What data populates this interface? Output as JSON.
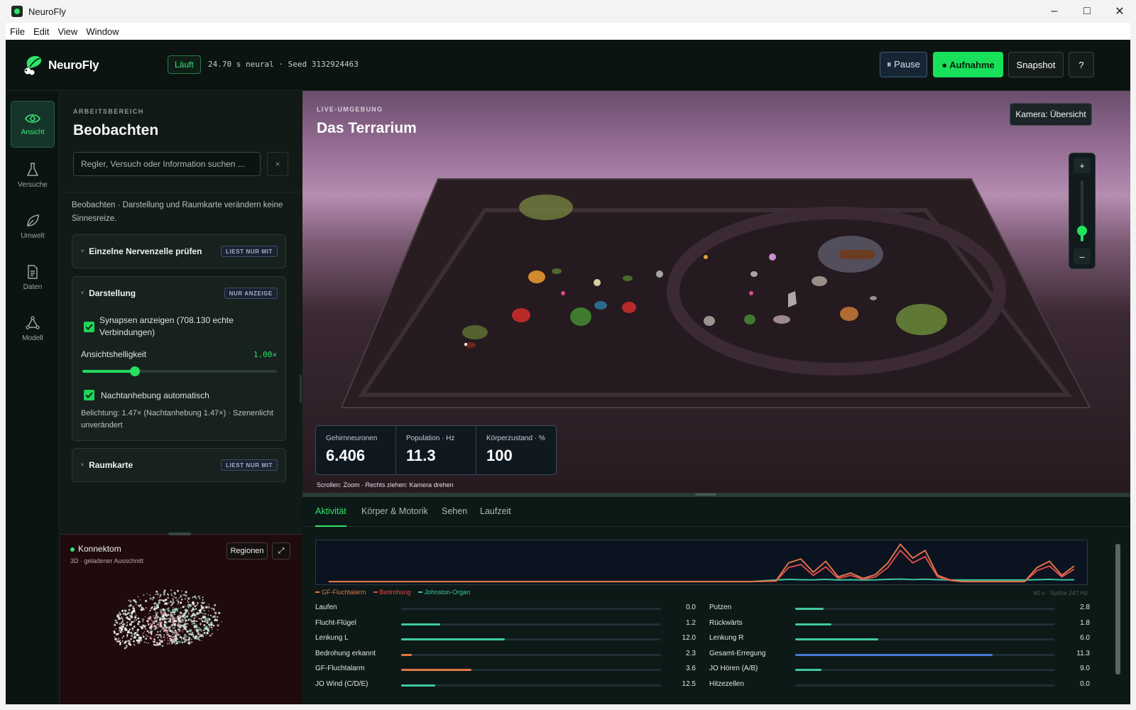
{
  "window": {
    "title": "NeuroFly",
    "minimize": "–",
    "maximize": "□",
    "close": "✕"
  },
  "menu": [
    "File",
    "Edit",
    "View",
    "Window"
  ],
  "header": {
    "logo": "NeuroFly",
    "status": "Läuft",
    "info": "24.70 s neural · Seed 3132924463",
    "pause": "⏸ Pause",
    "record": "● Aufnahme",
    "snapshot": "Snapshot",
    "help": "?"
  },
  "colors": {
    "accent": "#2fe36b",
    "record": "#18e05a"
  },
  "rail": [
    {
      "label": "Ansicht",
      "icon": "eye-icon",
      "active": true
    },
    {
      "label": "Versuche",
      "icon": "flask-icon",
      "active": false
    },
    {
      "label": "Umwelt",
      "icon": "leaf-icon",
      "active": false
    },
    {
      "label": "Daten",
      "icon": "document-icon",
      "active": false
    },
    {
      "label": "Modell",
      "icon": "graph-icon",
      "active": false
    }
  ],
  "workspace": {
    "label": "ARBEITSBEREICH",
    "title": "Beobachten",
    "search_placeholder": "Regler, Versuch oder Information suchen ...",
    "search_clear": "×",
    "description": "Beobachten · Darstellung und Raumkarte verändern keine Sinnesreize.",
    "sections": {
      "neuron": {
        "title": "Einzelne Nervenzelle prüfen",
        "badge": "LIEST NUR MIT",
        "caret": "˅"
      },
      "display": {
        "title": "Darstellung",
        "badge": "NUR ANZEIGE",
        "caret": "˅",
        "synapses_label": "Synapsen anzeigen (708.130 echte Verbindungen)",
        "synapses_checked": true,
        "brightness_label": "Ansichtshelligkeit",
        "brightness_value": "1.00×",
        "brightness_fraction": 0.27,
        "night_label": "Nachtanhebung automatisch",
        "night_checked": true,
        "exposure": "Belichtung: 1.47× (Nachtanhebung 1.47×) · Szenenlicht unverändert"
      },
      "map": {
        "title": "Raumkarte",
        "badge": "LIEST NUR MIT",
        "caret": "˅"
      }
    }
  },
  "connectome": {
    "title": "Konnektom",
    "subtitle": "3D · geladener Ausschnitt",
    "regions": "Regionen",
    "expand": "⤢"
  },
  "viewport": {
    "label": "LIVE-UMGEBUNG",
    "title": "Das Terrarium",
    "camera": "Kamera: Übersicht",
    "zoom_in": "+",
    "zoom_out": "–",
    "zoom_fraction": 0.18,
    "stats": [
      {
        "label": "Gehirnneuronen",
        "value": "6.406"
      },
      {
        "label": "Population · Hz",
        "value": "11.3"
      },
      {
        "label": "Körperzustand · %",
        "value": "100"
      }
    ],
    "hint": "Scrollen: Zoom · Rechts ziehen: Kamera drehen"
  },
  "tabs": [
    "Aktivität",
    "Körper & Motorik",
    "Sehen",
    "Laufzeit"
  ],
  "activity": {
    "legend": [
      {
        "name": "GF-Fluchtalarm",
        "color": "#e0764a"
      },
      {
        "name": "Bedrohung",
        "color": "#e04a4a"
      },
      {
        "name": "Johnston-Organ",
        "color": "#3ec9a0"
      }
    ],
    "caption": "60 s · Spitze 247 Hz",
    "left_metrics": [
      {
        "label": "Laufen",
        "value": "0.0",
        "fraction": 0.0,
        "color": "#3ec9a0"
      },
      {
        "label": "Flucht-Flügel",
        "value": "1.2",
        "fraction": 0.15,
        "color": "#3ec9a0"
      },
      {
        "label": "Lenkung L",
        "value": "12.0",
        "fraction": 0.4,
        "color": "#3ec9a0"
      },
      {
        "label": "Bedrohung erkannt",
        "value": "2.3",
        "fraction": 0.04,
        "color": "#e0764a"
      },
      {
        "label": "GF-Fluchtalarm",
        "value": "3.6",
        "fraction": 0.27,
        "color": "#e0764a"
      },
      {
        "label": "JO Wind (C/D/E)",
        "value": "12.5",
        "fraction": 0.13,
        "color": "#3ec9a0"
      }
    ],
    "right_metrics": [
      {
        "label": "Putzen",
        "value": "2.8",
        "fraction": 0.11,
        "color": "#3ec9a0"
      },
      {
        "label": "Rückwärts",
        "value": "1.8",
        "fraction": 0.14,
        "color": "#3ec9a0"
      },
      {
        "label": "Lenkung R",
        "value": "6.0",
        "fraction": 0.32,
        "color": "#3ec9a0"
      },
      {
        "label": "Gesamt-Erregung",
        "value": "11.3",
        "fraction": 0.76,
        "color": "#4a78d6"
      },
      {
        "label": "JO Hören (A/B)",
        "value": "9.0",
        "fraction": 0.1,
        "color": "#3ec9a0"
      },
      {
        "label": "Hitzezellen",
        "value": "0.0",
        "fraction": 0.0,
        "color": "#3ec9a0"
      }
    ]
  },
  "chart_data": {
    "type": "line",
    "title": "",
    "xlabel": "",
    "ylabel": "",
    "x": [
      0,
      2,
      4,
      6,
      8,
      10,
      12,
      14,
      16,
      18,
      20,
      22,
      24,
      26,
      28,
      30,
      32,
      34,
      36,
      37,
      38,
      39,
      40,
      41,
      42,
      43,
      44,
      45,
      46,
      47,
      48,
      49,
      50,
      51,
      52,
      53,
      54,
      55,
      56,
      57,
      58,
      59,
      60
    ],
    "ylim": [
      0,
      247
    ],
    "grid": false,
    "legend_position": "bottom-left",
    "series": [
      {
        "name": "GF-Fluchtalarm",
        "color": "#e0764a",
        "values": [
          0,
          0,
          0,
          0,
          0,
          0,
          0,
          0,
          0,
          0,
          0,
          0,
          0,
          0,
          0,
          0,
          0,
          0,
          5,
          120,
          145,
          60,
          130,
          30,
          55,
          20,
          45,
          120,
          240,
          150,
          200,
          40,
          10,
          0,
          0,
          0,
          0,
          0,
          0,
          90,
          130,
          40,
          100
        ]
      },
      {
        "name": "Bedrohung",
        "color": "#e04a4a",
        "values": [
          0,
          0,
          0,
          0,
          0,
          0,
          0,
          0,
          0,
          0,
          0,
          0,
          0,
          0,
          0,
          0,
          0,
          0,
          3,
          90,
          110,
          40,
          95,
          20,
          40,
          15,
          30,
          90,
          200,
          120,
          160,
          30,
          8,
          0,
          0,
          0,
          0,
          0,
          0,
          70,
          100,
          30,
          80
        ]
      },
      {
        "name": "Johnston-Organ",
        "color": "#3ec9a0",
        "values": [
          0,
          0,
          0,
          0,
          0,
          0,
          0,
          0,
          0,
          0,
          0,
          0,
          0,
          0,
          0,
          0,
          0,
          0,
          10,
          14,
          12,
          11,
          14,
          10,
          12,
          10,
          11,
          14,
          16,
          13,
          15,
          12,
          10,
          10,
          10,
          10,
          10,
          10,
          10,
          12,
          14,
          11,
          12
        ]
      }
    ]
  }
}
